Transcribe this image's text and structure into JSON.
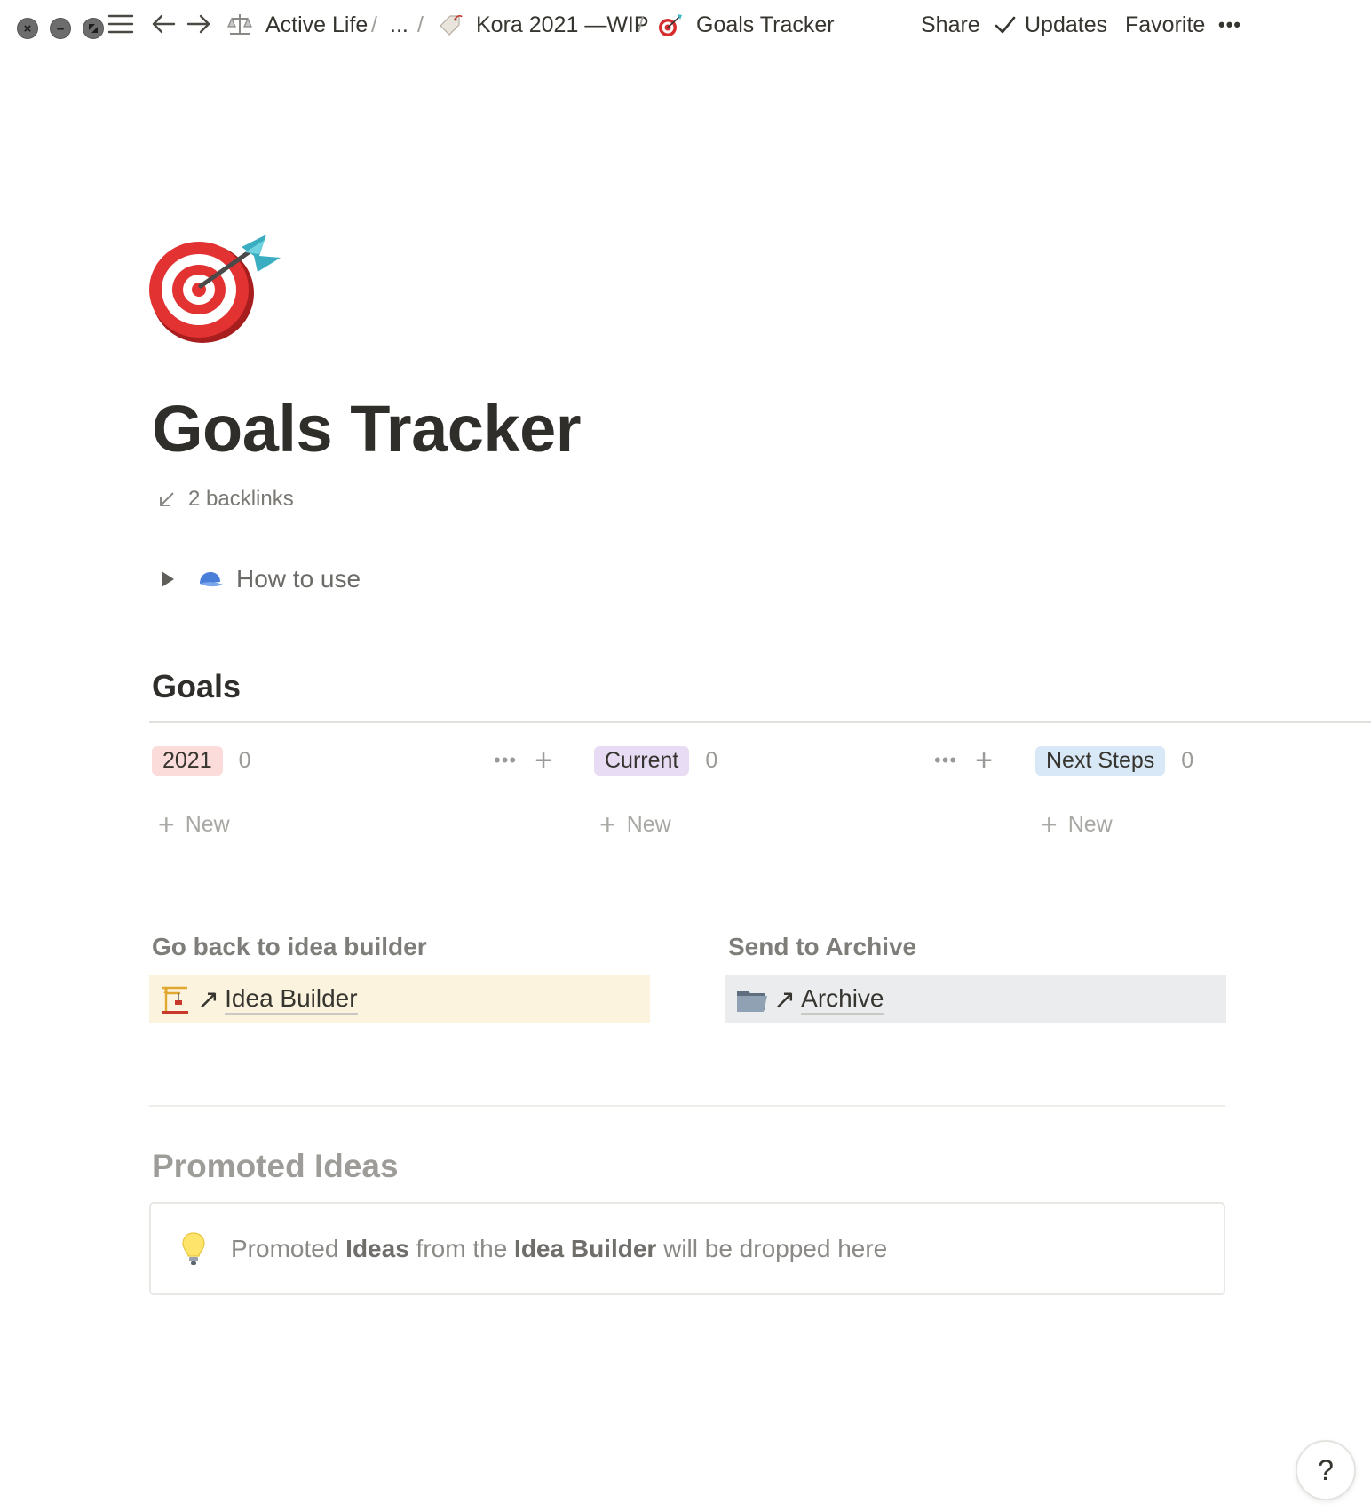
{
  "window_controls": {
    "close_icon": "close-icon",
    "minimize_icon": "minimize-icon",
    "fullscreen_icon": "fullscreen-icon"
  },
  "breadcrumb": {
    "items": [
      {
        "label": "Active Life",
        "icon": "balance-scale-icon"
      },
      {
        "label": "...",
        "icon": ""
      },
      {
        "label": "Kora 2021 —WIP",
        "icon": "price-tag-icon"
      },
      {
        "label": "Goals Tracker",
        "icon": "direct-hit-icon"
      }
    ],
    "separator": "/"
  },
  "topbar_actions": {
    "share": "Share",
    "updates": "Updates",
    "favorite": "Favorite",
    "more": "•••"
  },
  "page": {
    "icon": "direct-hit-icon",
    "title": "Goals Tracker",
    "backlinks": "2 backlinks"
  },
  "toggle": {
    "label": "How to use",
    "icon": "billed-cap-icon"
  },
  "goals": {
    "heading": "Goals",
    "columns": [
      {
        "label": "2021",
        "count": "0",
        "color": "#fbdcdb",
        "new_label": "New"
      },
      {
        "label": "Current",
        "count": "0",
        "color": "#e8dcf5",
        "new_label": "New"
      },
      {
        "label": "Next Steps",
        "count": "0",
        "color": "#d9e8f7",
        "new_label": "New"
      }
    ],
    "column_menu": "•••",
    "column_add": "+"
  },
  "links": [
    {
      "heading": "Go back to idea builder",
      "label": "Idea Builder",
      "icon": "building-construction-icon",
      "bg": "#fbf3dd"
    },
    {
      "heading": "Send to Archive",
      "label": "Archive",
      "icon": "file-folder-icon",
      "bg": "#ebeced"
    }
  ],
  "promoted": {
    "heading": "Promoted Ideas",
    "callout_icon": "light-bulb-icon",
    "callout": {
      "t1": "Promoted ",
      "b1": "Ideas",
      "t2": " from the ",
      "b2": "Idea Builder",
      "t3": " will be dropped here"
    }
  },
  "help": {
    "label": "?"
  }
}
